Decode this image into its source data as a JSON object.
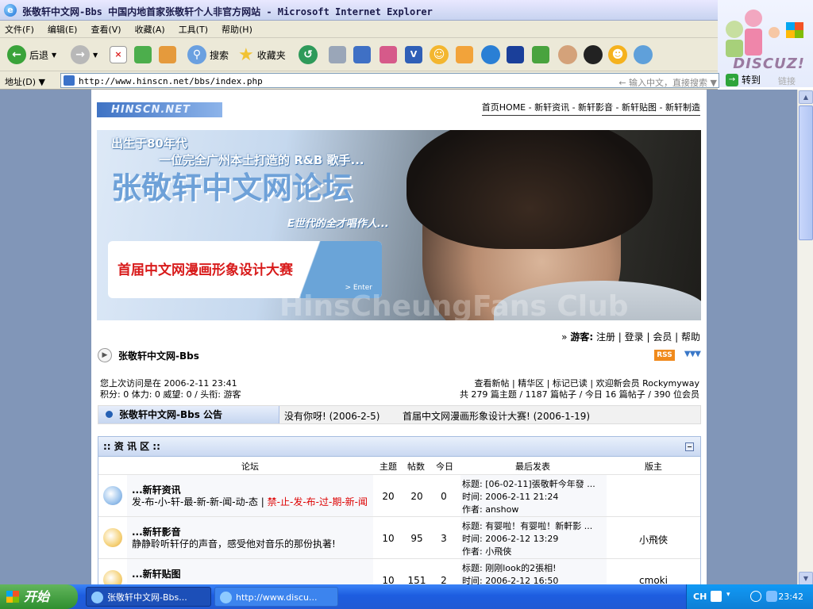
{
  "window": {
    "title": "张敬轩中文网-Bbs 中国内地首家张敬轩个人非官方网站 - Microsoft Internet Explorer"
  },
  "menubar": [
    "文件(F)",
    "编辑(E)",
    "查看(V)",
    "收藏(A)",
    "工具(T)",
    "帮助(H)"
  ],
  "toolbar": {
    "back": "后退",
    "search": "搜索",
    "favorites": "收藏夹"
  },
  "address": {
    "label": "地址(D)",
    "url": "http://www.hinscn.net/bbs/index.php",
    "hint": "输入中文，直接搜索",
    "go": "转到",
    "links": "链接"
  },
  "brand": {
    "discuz": "DISCUZ!"
  },
  "site": {
    "logo": "HINSCN.NET",
    "nav": "首页HOME - 新轩资讯 - 新轩影音 - 新轩贴图 - 新轩制造",
    "banner": {
      "line1": "出生于80年代",
      "line1b": "一位完全广州本土打造的 R&B 歌手...",
      "title": "张敬轩中文网论坛",
      "tagline": "E世代的全才唱作人...",
      "promo": "首届中文网漫画形象设计大赛",
      "enter": "> Enter",
      "watermark": "HinsCheungFans Club"
    },
    "userlinks": {
      "guest": "游客:",
      "links": "注册 | 登录 | 会员 | 帮助"
    },
    "forum_title": "张敬轩中文网-Bbs",
    "rss": "RSS",
    "info_left": [
      "您上次访问是在 2006-2-11 23:41",
      "积分: 0 体力: 0 威望: 0 / 头衔: 游客"
    ],
    "info_right": [
      "查看新帖 | 精华区 | 标记已读 | 欢迎新会员 Rockymyway",
      "共 279 篇主题 / 1187 篇帖子 / 今日 16 篇帖子 / 390 位会员"
    ],
    "notice": {
      "tab": "张敬轩中文网-Bbs 公告",
      "item1": "没有你呀! (2006-2-5)",
      "item2": "首届中文网漫画形象设计大赛! (2006-1-19)"
    },
    "section": {
      "title": ":: 资 讯 区 ::",
      "columns": {
        "forum": "论坛",
        "topics": "主题",
        "posts": "帖数",
        "today": "今日",
        "last": "最后发表",
        "moderator": "版主"
      },
      "rows": [
        {
          "name": "...新轩资讯",
          "desc": "发-布-小-轩-最-新-新-闻-动-态 |",
          "desc2": "禁-止-发-布-过-期-新-闻",
          "topics": "20",
          "posts": "20",
          "today": "0",
          "last_title": "标题: [06-02-11]張敬軒今年發 ...",
          "last_time": "时间: 2006-2-11 21:24",
          "last_author": "作者: anshow",
          "mod": ""
        },
        {
          "name": "...新轩影音",
          "desc": "静静聆听轩仔的声音，感受他对音乐的那份执著!",
          "desc2": "",
          "topics": "10",
          "posts": "95",
          "today": "3",
          "last_title": "标题: 有婴啦！有婴啦！新軒影 ...",
          "last_time": "时间: 2006-2-12 13:29",
          "last_author": "作者: 小飛俠",
          "mod": "小飛俠"
        },
        {
          "name": "...新轩贴图",
          "desc": "",
          "desc2": "",
          "topics": "10",
          "posts": "151",
          "today": "2",
          "last_title": "标题: 刚刚look的2張相!",
          "last_time": "时间: 2006-2-12 16:50",
          "last_author": "",
          "mod": "cmoki"
        }
      ]
    }
  },
  "taskbar": {
    "start": "开始",
    "task1": "张敬轩中文网-Bbs...",
    "task2": "http://www.discu...",
    "lang": "CH",
    "clock": "23:42"
  }
}
